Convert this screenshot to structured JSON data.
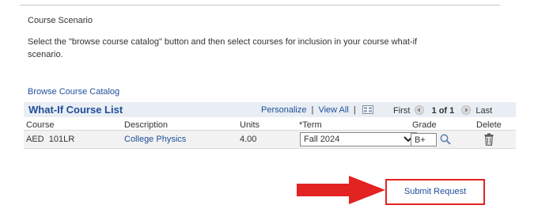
{
  "section": {
    "title": "Course Scenario",
    "instructions": "Select the \"browse course catalog\" button and then select courses for inclusion in your course what-if scenario."
  },
  "browse_link": "Browse Course Catalog",
  "grid": {
    "title": "What-If Course List",
    "personalize": "Personalize",
    "view_all": "View All",
    "separator": "|",
    "nav_first": "First",
    "page_count": "1 of 1",
    "nav_last": "Last",
    "columns": {
      "course": "Course",
      "description": "Description",
      "units": "Units",
      "term": "*Term",
      "grade": "Grade",
      "delete": "Delete"
    },
    "rows": [
      {
        "course": "AED  101LR",
        "description": "College Physics",
        "units": "4.00",
        "term": "Fall 2024",
        "grade": "B+"
      }
    ]
  },
  "submit_label": "Submit Request",
  "colors": {
    "link": "#1f4e9a",
    "grid_header_bg": "#e9eef4",
    "row_bg": "#f2f2f2",
    "highlight_red": "#e32222"
  },
  "icons": [
    "zoom-grid-icon",
    "previous-row-icon",
    "next-row-icon",
    "chevron-down-icon",
    "search-icon",
    "trash-icon",
    "red-arrow-icon"
  ]
}
